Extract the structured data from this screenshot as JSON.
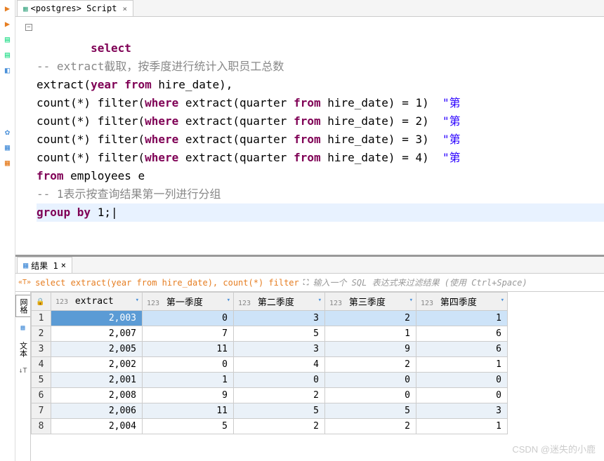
{
  "tab": {
    "title": "<postgres> Script",
    "close": "×"
  },
  "code": {
    "l1": "select",
    "l2_a": "-- ",
    "l2_b": "extract截取，按季度进行统计入职员工总数",
    "l3_a": "extract(",
    "l3_b": "year from",
    "l3_c": " hire_date),",
    "l4_a": "count(*) filter(",
    "l4_b": "where",
    "l4_c": " extract(quarter ",
    "l4_d": "from",
    "l4_e": " hire_date) = 1)  ",
    "l4_f": "\"第",
    "l5_e": " hire_date) = 2)  ",
    "l6_e": " hire_date) = 3)  ",
    "l7_e": " hire_date) = 4)  ",
    "l8_a": "from",
    "l8_b": " employees e",
    "l9": "-- 1表示按查询结果第一列进行分组",
    "l10_a": "group by",
    "l10_b": " 1;"
  },
  "results": {
    "tab_label": "结果 1",
    "tab_close": "×",
    "sql_preview": "select extract(year from hire_date), count(*) filter",
    "filter_placeholder": "输入一个 SQL 表达式来过滤结果 (使用 Ctrl+Space)",
    "side_tabs": [
      "网格",
      "文本"
    ],
    "type_badge": "123",
    "columns": [
      "extract",
      "第一季度",
      "第二季度",
      "第三季度",
      "第四季度"
    ],
    "rows": [
      [
        "2,003",
        "0",
        "3",
        "2",
        "1"
      ],
      [
        "2,007",
        "7",
        "5",
        "1",
        "6"
      ],
      [
        "2,005",
        "11",
        "3",
        "9",
        "6"
      ],
      [
        "2,002",
        "0",
        "4",
        "2",
        "1"
      ],
      [
        "2,001",
        "1",
        "0",
        "0",
        "0"
      ],
      [
        "2,008",
        "9",
        "2",
        "0",
        "0"
      ],
      [
        "2,006",
        "11",
        "5",
        "5",
        "3"
      ],
      [
        "2,004",
        "5",
        "2",
        "2",
        "1"
      ]
    ]
  },
  "watermark": "CSDN @迷失的小鹿",
  "icons": {
    "play": "▶",
    "play2": "▶",
    "doc1": "▤",
    "doc2": "▤",
    "blue1": "◧",
    "gear": "✿",
    "db1": "▦",
    "db2": "▦",
    "grid": "▦",
    "minus": "−",
    "expand": "⛶",
    "tt": "«T»",
    "tdn": "↓T"
  }
}
